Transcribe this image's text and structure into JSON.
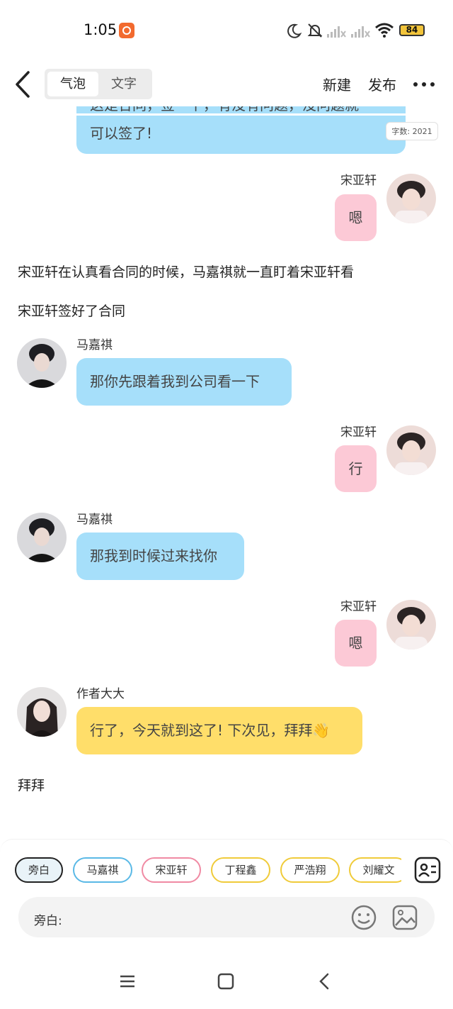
{
  "status_bar": {
    "time": "1:05",
    "battery": "84"
  },
  "header": {
    "tabs": [
      {
        "label": "气泡",
        "active": true
      },
      {
        "label": "文字",
        "active": false
      }
    ],
    "new_label": "新建",
    "publish_label": "发布"
  },
  "word_count": "字数: 2021",
  "messages": {
    "m0": {
      "partial_line": "这是合同，签一下，有没有问题，没问题就",
      "text": "可以签了!"
    },
    "m1": {
      "name": "宋亚轩",
      "text": "嗯"
    },
    "n1": "宋亚轩在认真看合同的时候，马嘉祺就一直盯着宋亚轩看",
    "n2": "宋亚轩签好了合同",
    "m2": {
      "name": "马嘉祺",
      "text": "那你先跟着我到公司看一下"
    },
    "m3": {
      "name": "宋亚轩",
      "text": "行"
    },
    "m4": {
      "name": "马嘉祺",
      "text": "那我到时候过来找你"
    },
    "m5": {
      "name": "宋亚轩",
      "text": "嗯"
    },
    "m6": {
      "name": "作者大大",
      "text": "行了，今天就到这了! 下次见，拜拜👋"
    },
    "n3": "拜拜"
  },
  "characters": [
    "旁白",
    "马嘉祺",
    "宋亚轩",
    "丁程鑫",
    "严浩翔",
    "刘耀文"
  ],
  "input": {
    "label": "旁白:"
  },
  "colors": {
    "blue_bubble": "#a6dffa",
    "pink_bubble": "#fcc9d6",
    "yellow_bubble": "#ffde6a"
  }
}
